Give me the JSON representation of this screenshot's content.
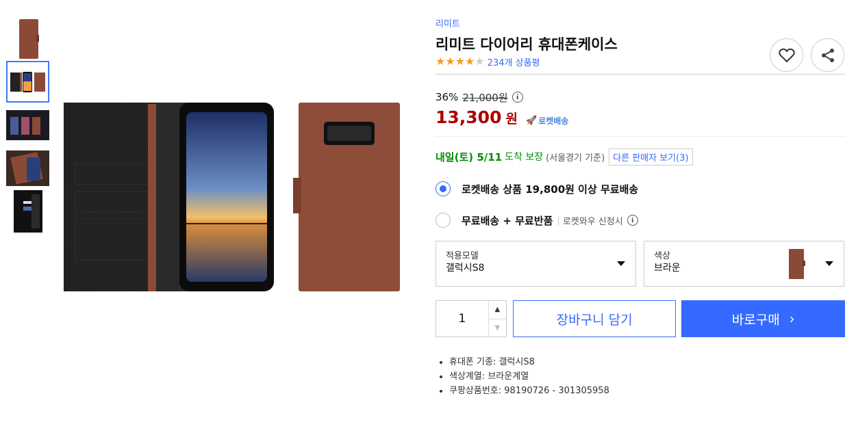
{
  "brand": "리미트",
  "title": "리미트 다이어리 휴대폰케이스",
  "rating": {
    "stars": 4,
    "max": 5,
    "review_count": "234개 상품평"
  },
  "price": {
    "discount": "36%",
    "original": "21,000원",
    "sale": "13,300",
    "won": "원",
    "rocket_label": "로켓배송"
  },
  "delivery": {
    "date": "내일(토) 5/11",
    "arrive": "도착 보장",
    "region": "(서울경기 기준)",
    "other_sellers": "다른 판매자 보기(3)"
  },
  "shipping_options": [
    {
      "label": "로켓배송 상품 19,800원 이상 무료배송",
      "sub": "",
      "checked": true
    },
    {
      "label": "무료배송 + 무료반품",
      "sub": "로켓와우 신청시",
      "checked": false
    }
  ],
  "selects": {
    "model": {
      "label": "적용모델",
      "value": "갤럭시S8"
    },
    "color": {
      "label": "색상",
      "value": "브라운"
    }
  },
  "quantity": "1",
  "buttons": {
    "cart": "장바구니 담기",
    "buy": "바로구매"
  },
  "details": [
    "휴대폰 기종: 갤럭시S8",
    "색상계열: 브라운계열",
    "쿠팡상품번호: 98190726 - 301305958"
  ],
  "colors": {
    "accent": "#346aff",
    "price": "#ae0000",
    "delivery": "#008c00",
    "star": "#f79a1c",
    "case_brown": "#8b4a35"
  }
}
